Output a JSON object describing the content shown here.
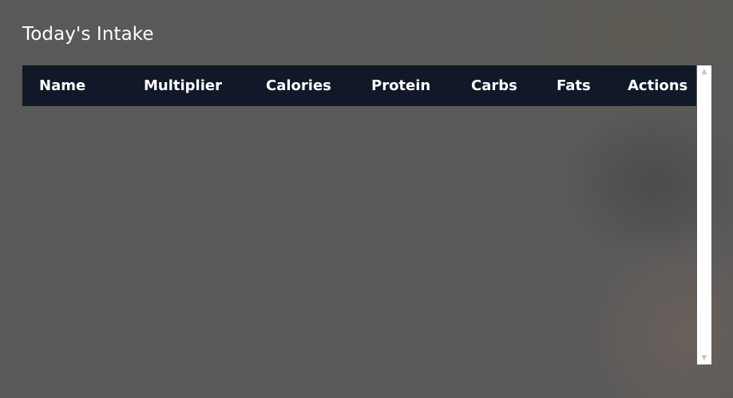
{
  "title": "Today's Intake",
  "table": {
    "headers": {
      "name": "Name",
      "multiplier": "Multiplier",
      "calories": "Calories",
      "protein": "Protein",
      "carbs": "Carbs",
      "fats": "Fats",
      "actions": "Actions"
    },
    "rows": []
  },
  "scrollbar": {
    "up_icon": "chevron-up-icon",
    "down_icon": "chevron-down-icon"
  },
  "colors": {
    "header_bg": "#111827",
    "header_text": "#ffffff",
    "background": "#595959"
  }
}
